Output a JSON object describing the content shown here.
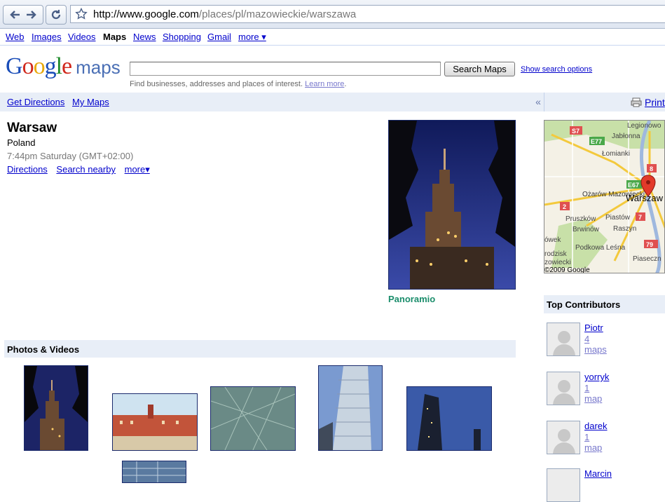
{
  "browser": {
    "url_host": "http://www.google.com",
    "url_path": "/places/pl/mazowieckie/warszawa"
  },
  "gbar": {
    "items": [
      "Web",
      "Images",
      "Videos",
      "Maps",
      "News",
      "Shopping",
      "Gmail",
      "more ▾"
    ],
    "current": "Maps"
  },
  "header": {
    "logo_text": "Google",
    "logo_suffix": "maps",
    "search_value": "",
    "search_button": "Search Maps",
    "search_options": "Show search options",
    "hint_text": "Find businesses, addresses and places of interest.",
    "hint_link": "Learn more",
    "hint_end": "."
  },
  "nav": {
    "get_directions": "Get Directions",
    "my_maps": "My Maps",
    "collapse": "«",
    "print": "Print"
  },
  "place": {
    "title": "Warsaw",
    "country": "Poland",
    "time": "7:44pm Saturday (GMT+02:00)",
    "links": [
      "Directions",
      "Search nearby",
      "more▾"
    ],
    "photo_credit": "Panoramio"
  },
  "photos": {
    "title": "Photos & Videos"
  },
  "map": {
    "labels": [
      "Legionowo",
      "Jabłonna",
      "Łomianki",
      "Ożarów Mazowiecki",
      "Warszaw",
      "Pruszków",
      "Piastów",
      "Brwinów",
      "Raszyn",
      "Podkowa Leśna",
      "ówek",
      "rodzisk",
      "zowiecki",
      "Piaseczn"
    ],
    "road_labels": [
      "S7",
      "E77",
      "8",
      "E67",
      "2",
      "7",
      "79"
    ],
    "copyright": "©2009 Google"
  },
  "contributors": {
    "title": "Top Contributors",
    "items": [
      {
        "name": "Piotr",
        "count": "4 maps"
      },
      {
        "name": "yorryk",
        "count": "1 map"
      },
      {
        "name": "darek",
        "count": "1 map"
      },
      {
        "name": "Marcin",
        "count": ""
      }
    ]
  },
  "colors": {
    "link": "#0000cc",
    "bar": "#e8eef7",
    "panoramio": "#1a8d6b",
    "photo_border": "#1a2a6c"
  }
}
